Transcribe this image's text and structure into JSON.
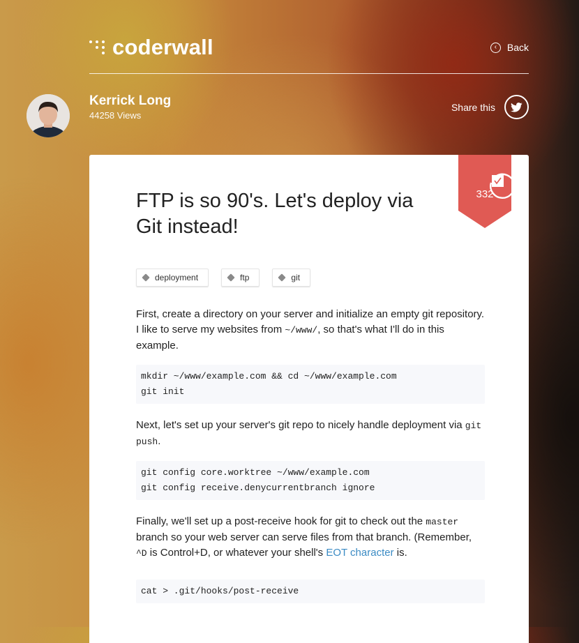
{
  "header": {
    "logo_text": "coderwall",
    "back_label": "Back"
  },
  "author": {
    "name": "Kerrick Long",
    "views": "44258 Views"
  },
  "share": {
    "label": "Share this"
  },
  "protip": {
    "upvotes": "332",
    "title": "FTP is so 90's. Let's deploy via Git instead!",
    "tags": [
      "deployment",
      "ftp",
      "git"
    ],
    "para1": {
      "before": "First, create a directory on your server and initialize an empty git repository. I like to serve my websites from ",
      "code": "~/www/",
      "after": ", so that's what I'll do in this example."
    },
    "code1": [
      "mkdir ~/www/example.com && cd ~/www/example.com",
      "git init"
    ],
    "para2": {
      "before": "Next, let's set up your server's git repo to nicely handle deployment via ",
      "code": "git push",
      "after": "."
    },
    "code2": [
      "git config core.worktree ~/www/example.com",
      "git config receive.denycurrentbranch ignore"
    ],
    "para3": {
      "before": "Finally, we'll set up a post-receive hook for git to check out the ",
      "code1": "master",
      "middle": " branch so your web server can serve files from that branch. (Remember, ",
      "code2": "^D",
      "middle2": " is Control+D, or whatever your shell's ",
      "link": "EOT character",
      "after": " is."
    },
    "code3": [
      "cat > .git/hooks/post-receive"
    ]
  },
  "colors": {
    "ribbon": "#e05a54",
    "link": "#3b8bc4"
  }
}
